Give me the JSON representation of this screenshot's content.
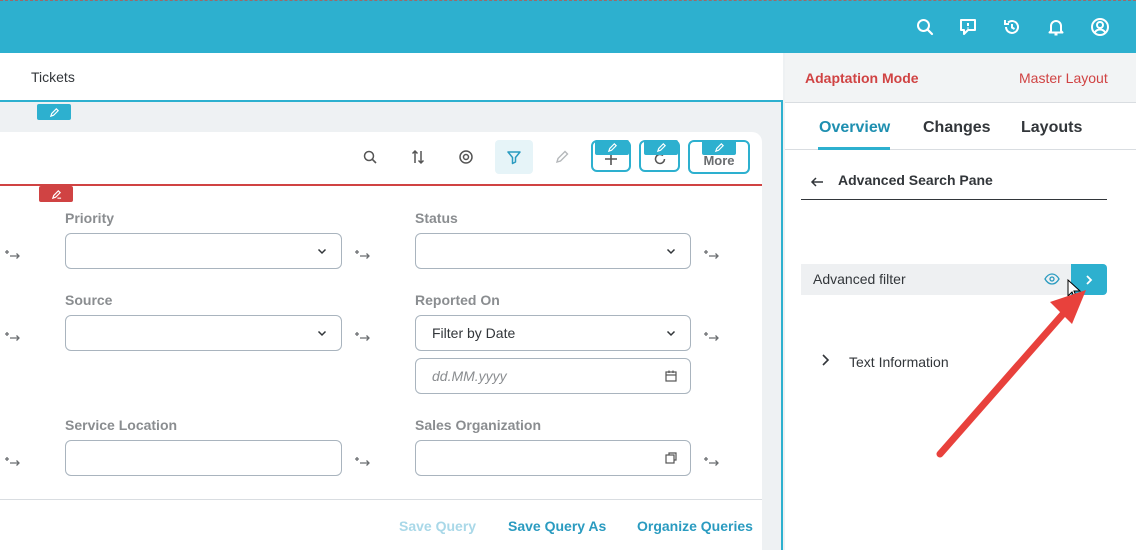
{
  "colors": {
    "shell": "#2db0cf",
    "accent": "#2a9bc0",
    "adaptation_red": "#d04343",
    "annotation_arrow": "#e8413c"
  },
  "shell": {
    "icons": [
      "search-icon",
      "feedback-icon",
      "history-icon",
      "notification-bell-icon",
      "user-avatar-icon"
    ]
  },
  "breadcrumb": {
    "current": "Tickets"
  },
  "toolbar": {
    "icons": [
      "search-icon",
      "sort-icon",
      "group-icon",
      "filter-icon",
      "edit-pencil-icon"
    ],
    "more_label": "More"
  },
  "filters": {
    "priority": {
      "label": "Priority",
      "value": ""
    },
    "status": {
      "label": "Status",
      "value": ""
    },
    "source": {
      "label": "Source",
      "value": ""
    },
    "reported_on": {
      "label": "Reported On",
      "value": "Filter by Date",
      "date_placeholder": "dd.MM.yyyy"
    },
    "service_location": {
      "label": "Service Location",
      "value": ""
    },
    "sales_organization": {
      "label": "Sales Organization",
      "value": ""
    }
  },
  "query_actions": {
    "save": "Save Query",
    "save_as": "Save Query As",
    "organize": "Organize Queries"
  },
  "adaptation": {
    "mode_label": "Adaptation Mode",
    "layout_label": "Master Layout",
    "tabs": [
      {
        "label": "Overview",
        "active": true
      },
      {
        "label": "Changes",
        "active": false
      },
      {
        "label": "Layouts",
        "active": false
      }
    ],
    "pane_title": "Advanced Search Pane",
    "advanced_filter_label": "Advanced filter",
    "text_information_label": "Text Information"
  }
}
